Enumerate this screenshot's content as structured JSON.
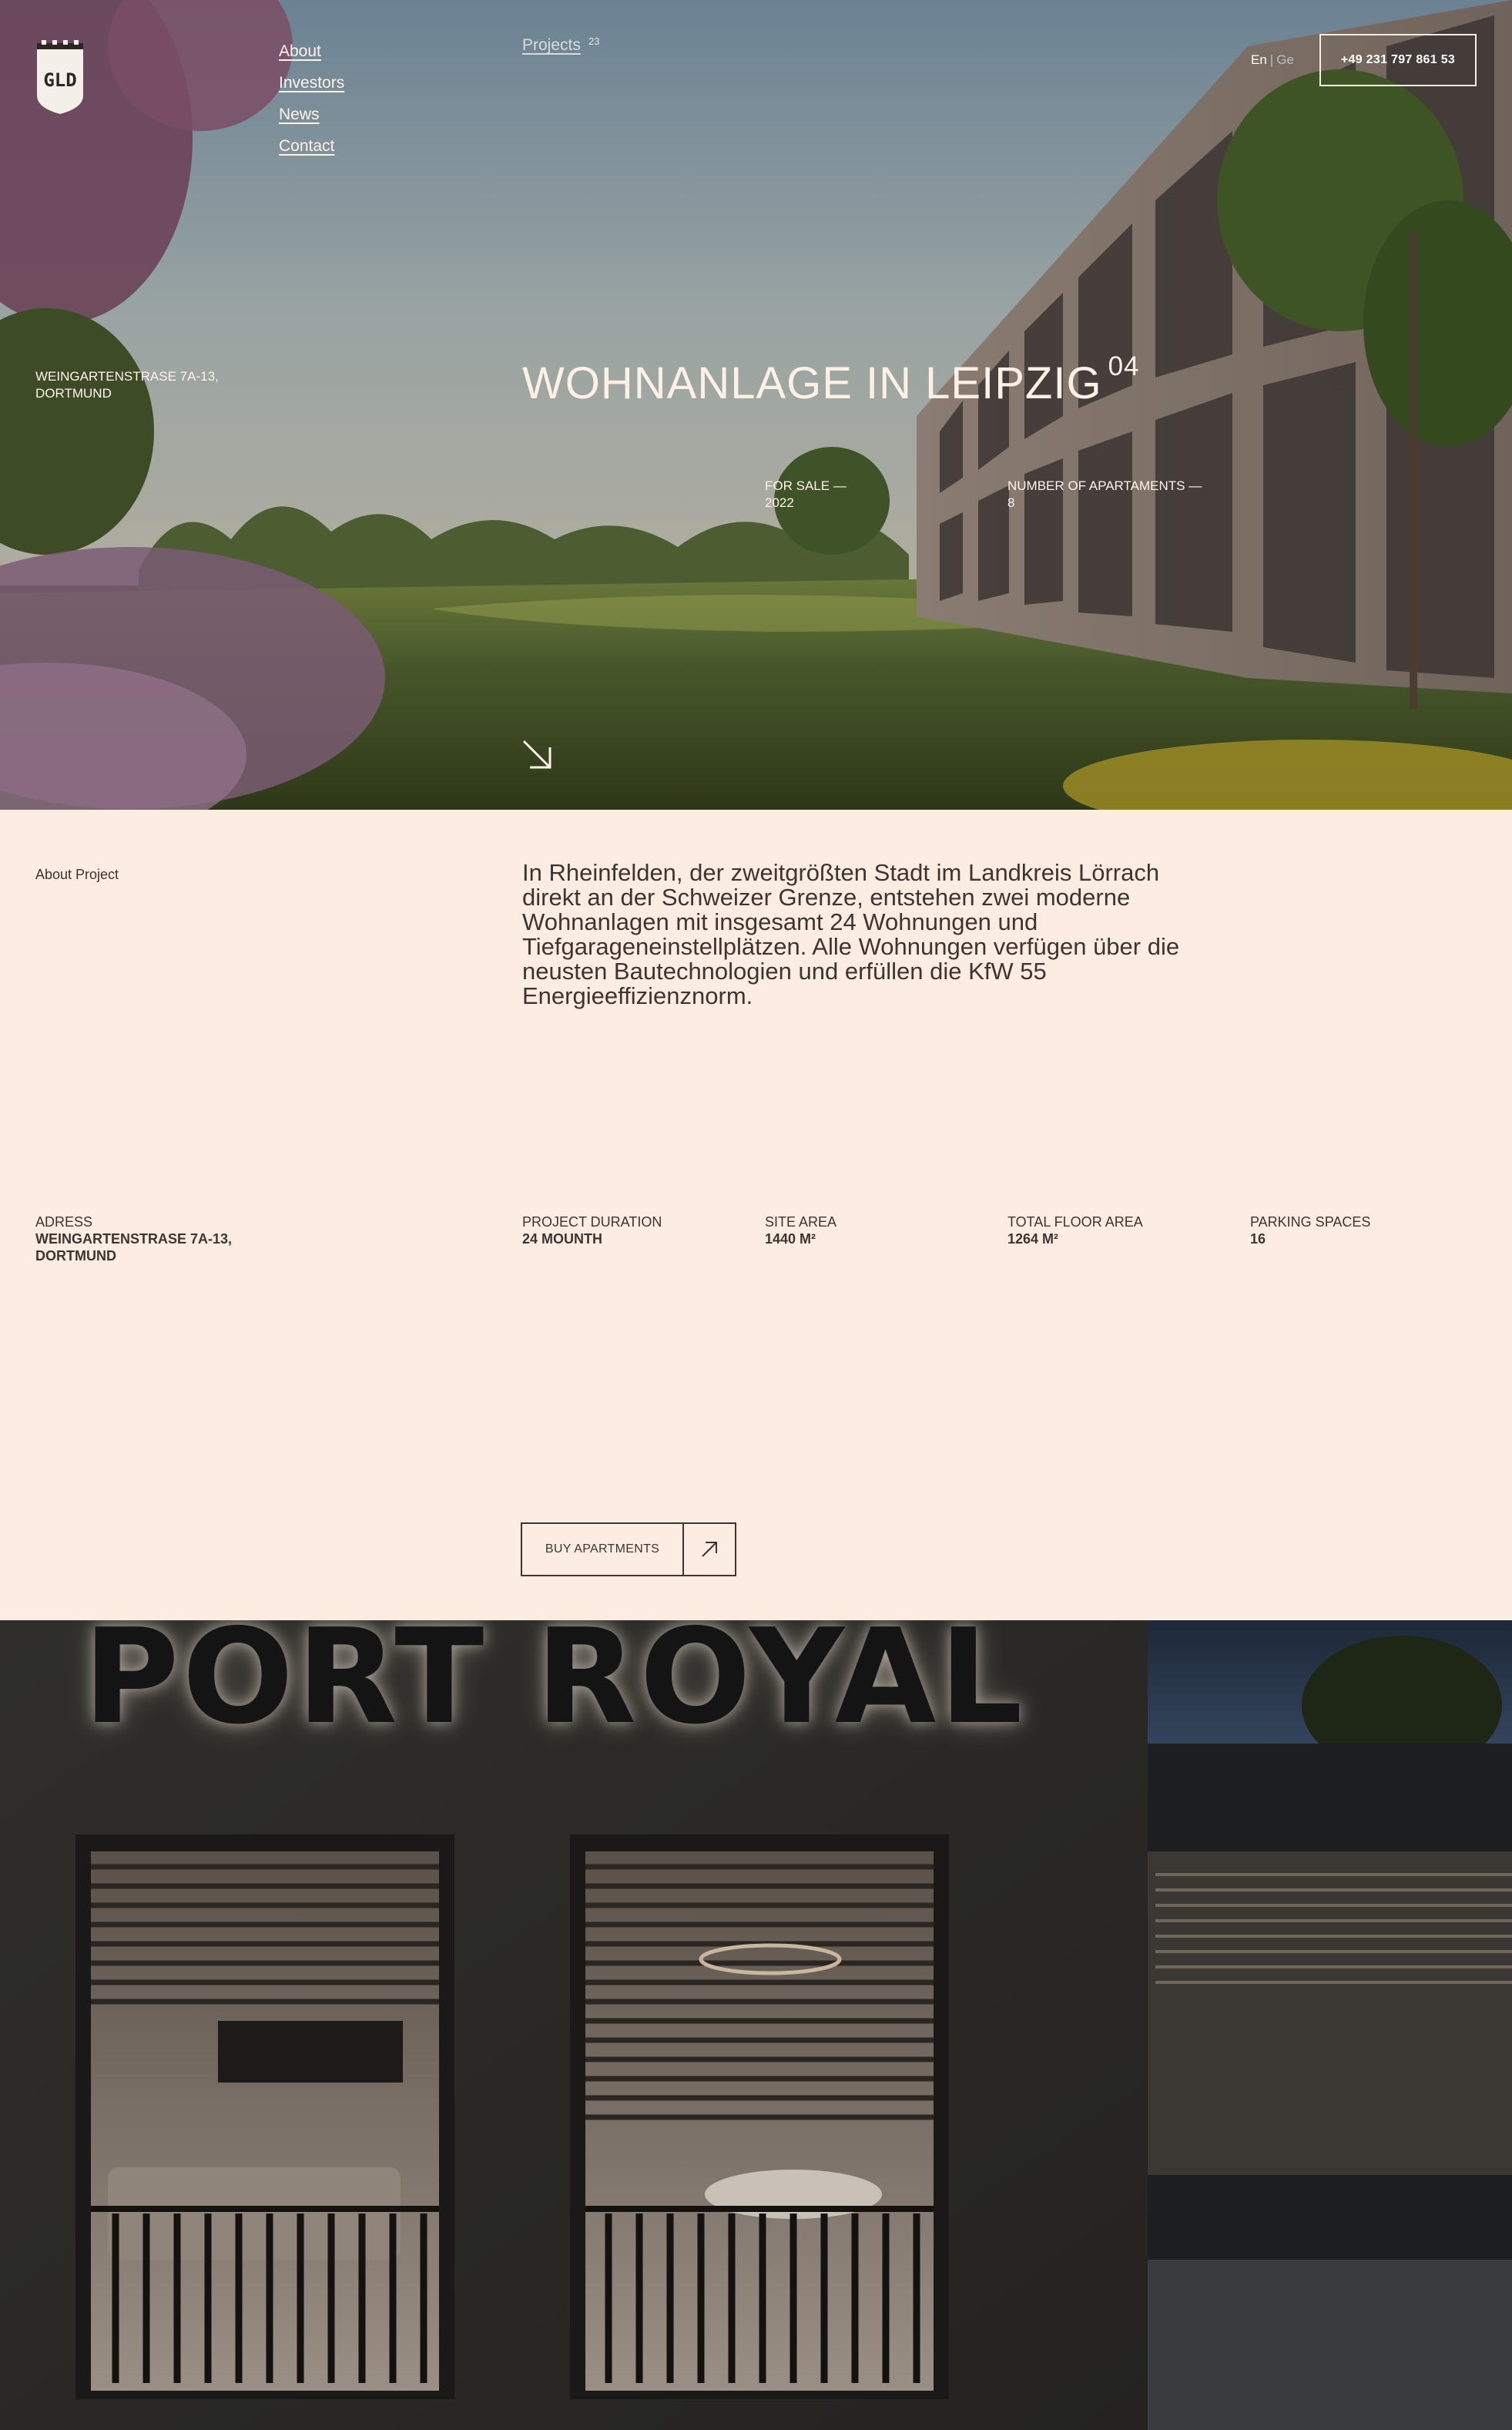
{
  "nav": {
    "items": [
      {
        "label": "About"
      },
      {
        "label": "Investors"
      },
      {
        "label": "News"
      },
      {
        "label": "Contact"
      }
    ],
    "projects_label": "Projects",
    "projects_count": "23",
    "lang_en": "En",
    "lang_separator": "|",
    "lang_ge": "Ge",
    "phone": "+49 231 797 861 53"
  },
  "logo": {
    "text": "GLD"
  },
  "hero": {
    "address": "WEINGARTENSTRASE 7A-13, DORTMUND",
    "title": "WOHNANLAGE IN LEIPZIG",
    "title_index": "04",
    "facts": [
      {
        "label": "FOR SALE —",
        "value": "2022"
      },
      {
        "label": "NUMBER OF APARTAMENTS —",
        "value": "8"
      }
    ],
    "arrow_icon": "arrow-down-right-icon"
  },
  "about": {
    "label": "About Project",
    "text": "In Rheinfelden, der zweitgrößten Stadt im Landkreis Lörrach direkt an der Schweizer Grenze, entstehen zwei moderne Wohnanlagen mit insgesamt 24 Wohnungen und Tiefgarageneinstellplätzen. Alle Wohnungen verfügen über die neusten Bautechnologien und erfüllen die KfW 55 Energieeffizienznorm.",
    "stats": [
      {
        "label": "ADRESS",
        "value": "WEINGARTENSTRASE 7A-13, DORTMUND"
      },
      {
        "label": "PROJECT DURATION",
        "value": "24 MOUNTH"
      },
      {
        "label": "SITE AREA",
        "value": "1440 M²"
      },
      {
        "label": "TOTAL FLOOR AREA",
        "value": "1264 M²"
      },
      {
        "label": "PARKING SPACES",
        "value": "16"
      }
    ],
    "buy_label": "BUY APARTMENTS",
    "buy_icon": "arrow-up-right-icon"
  },
  "night_image": {
    "sign_text": "PORT ROYAL"
  },
  "colors": {
    "page_bg": "#fdece2",
    "text": "#3d3532",
    "hero_text": "#fdf3ea"
  }
}
